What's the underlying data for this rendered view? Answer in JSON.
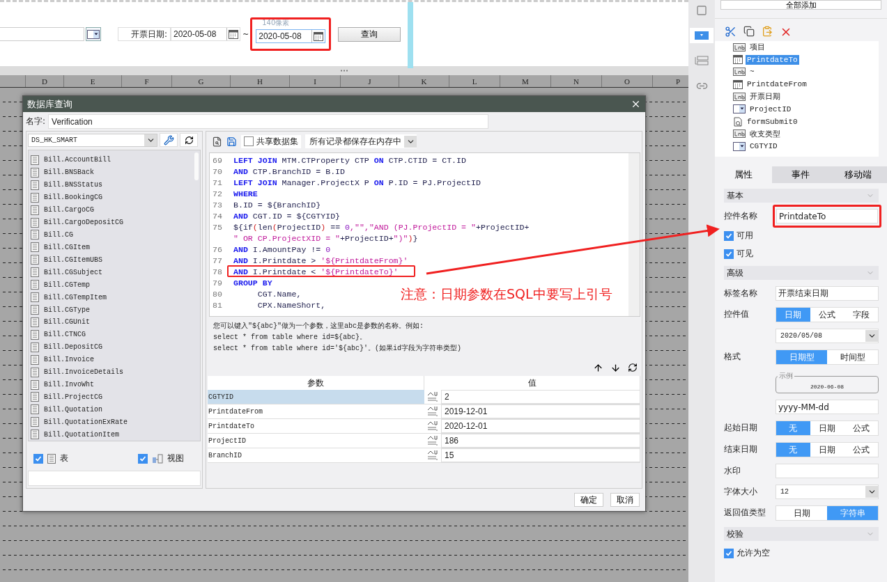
{
  "top_form": {
    "date_label": "开票日期:",
    "date_from": "2020-05-08",
    "separator": "~",
    "size_hint": "140像素",
    "date_to": "2020-05-08",
    "query_button": "查询"
  },
  "sheet": {
    "columns": [
      "D",
      "E",
      "F",
      "G",
      "H",
      "I",
      "J",
      "K",
      "L",
      "M",
      "N",
      "O",
      "P"
    ]
  },
  "dialog": {
    "title": "数据库查询",
    "name_label": "名字:",
    "name_value": "Verification",
    "datasource": "DS_HK_SMART",
    "tables": [
      "Bill.AccountBill",
      "Bill.BNSBack",
      "Bill.BNSStatus",
      "Bill.BookingCG",
      "Bill.CargoCG",
      "Bill.CargoDepositCG",
      "Bill.CG",
      "Bill.CGItem",
      "Bill.CGItemUBS",
      "Bill.CGSubject",
      "Bill.CGTemp",
      "Bill.CGTempItem",
      "Bill.CGType",
      "Bill.CGUnit",
      "Bill.CTNCG",
      "Bill.DepositCG",
      "Bill.Invoice",
      "Bill.InvoiceDetails",
      "Bill.InvoWht",
      "Bill.ProjectCG",
      "Bill.Quotation",
      "Bill.QuotationExRate",
      "Bill.QuotationItem"
    ],
    "filters": [
      {
        "kind": "table",
        "label": "表",
        "checked": true
      },
      {
        "kind": "view",
        "label": "视图",
        "checked": true
      }
    ],
    "share_label": "共享数据集",
    "share_checked": false,
    "cache_mode": "所有记录都保存在内存中",
    "sql_lines": [
      {
        "no": "69",
        "segments": [
          {
            "kind": "kw",
            "text": "LEFT JOIN "
          },
          {
            "kind": "id",
            "text": "MTM.CTProperty CTP "
          },
          {
            "kind": "kw",
            "text": "ON "
          },
          {
            "kind": "id",
            "text": "CTP.CTID = CT.ID"
          }
        ]
      },
      {
        "no": "70",
        "segments": [
          {
            "kind": "kw",
            "text": "AND "
          },
          {
            "kind": "id",
            "text": "CTP.BranchID = B.ID"
          }
        ]
      },
      {
        "no": "71",
        "segments": [
          {
            "kind": "kw",
            "text": "LEFT JOIN "
          },
          {
            "kind": "id",
            "text": "Manager.ProjectX P "
          },
          {
            "kind": "kw",
            "text": "ON "
          },
          {
            "kind": "id",
            "text": "P.ID = PJ.ProjectID"
          }
        ]
      },
      {
        "no": "72",
        "segments": [
          {
            "kind": "kw",
            "text": "WHERE"
          }
        ]
      },
      {
        "no": "73",
        "segments": [
          {
            "kind": "id",
            "text": "B.ID = ${BranchID}"
          }
        ]
      },
      {
        "no": "74",
        "segments": [
          {
            "kind": "kw",
            "text": "AND "
          },
          {
            "kind": "id",
            "text": "CGT.ID = ${CGTYID}"
          }
        ]
      },
      {
        "no": "75",
        "segments": [
          {
            "kind": "id",
            "text": "${if"
          },
          {
            "kind": "paren",
            "text": "("
          },
          {
            "kind": "id",
            "text": "len"
          },
          {
            "kind": "paren",
            "text": "("
          },
          {
            "kind": "id",
            "text": "ProjectID"
          },
          {
            "kind": "paren",
            "text": ")"
          },
          {
            "kind": "id",
            "text": " == "
          },
          {
            "kind": "num",
            "text": "0"
          },
          {
            "kind": "str",
            "text": ",\"\",\"AND (PJ.ProjectID = \""
          },
          {
            "kind": "id",
            "text": "+ProjectID+"
          }
        ]
      },
      {
        "segments": [
          {
            "kind": "str",
            "text": "\" OR CP.ProjectXID = \""
          },
          {
            "kind": "id",
            "text": "+ProjectID+"
          },
          {
            "kind": "str",
            "text": "\")\""
          },
          {
            "kind": "paren",
            "text": ")"
          },
          {
            "kind": "id",
            "text": "}"
          }
        ]
      },
      {
        "no": "76",
        "segments": [
          {
            "kind": "kw",
            "text": "AND "
          },
          {
            "kind": "id",
            "text": "I.AmountPay != "
          },
          {
            "kind": "num",
            "text": "0"
          }
        ]
      },
      {
        "no": "77",
        "segments": [
          {
            "kind": "kw",
            "text": "AND "
          },
          {
            "kind": "id",
            "text": "I.Printdate > "
          },
          {
            "kind": "str",
            "text": "'${PrintdateFrom}'"
          }
        ]
      },
      {
        "no": "78",
        "marked": true,
        "segments": [
          {
            "kind": "kw",
            "text": "AND "
          },
          {
            "kind": "id",
            "text": "I.Printdate < "
          },
          {
            "kind": "str",
            "text": "'${PrintdateTo}'"
          }
        ]
      },
      {
        "no": "79",
        "segments": [
          {
            "kind": "kw",
            "text": "GROUP BY"
          }
        ]
      },
      {
        "no": "80",
        "segments": [
          {
            "kind": "id",
            "text": "     CGT.Name,"
          }
        ]
      },
      {
        "no": "81",
        "segments": [
          {
            "kind": "id",
            "text": "     CPX.NameShort,"
          }
        ]
      }
    ],
    "help_lines": [
      "您可以键入\"${abc}\"做为一个参数，这里abc是参数的名称。例如:",
      "select * from table where id=${abc}。",
      "select * from table where id='${abc}'。(如果id字段为字符串类型)"
    ],
    "param_columns": [
      "参数",
      "值"
    ],
    "params": [
      {
        "name": "CGTYID",
        "value": "2",
        "selected": true
      },
      {
        "name": "PrintdateFrom",
        "value": "2019-12-01",
        "selected": false
      },
      {
        "name": "PrintdateTo",
        "value": "2020-12-01",
        "selected": false
      },
      {
        "name": "ProjectID",
        "value": "186",
        "selected": false
      },
      {
        "name": "BranchID",
        "value": "15",
        "selected": false
      }
    ],
    "buttons": [
      "确定",
      "取消"
    ]
  },
  "annotation": {
    "note": "注意：日期参数在SQL中要写上引号"
  },
  "side_tools": [
    {
      "kind": "frame",
      "selected": false
    },
    {
      "kind": "combo",
      "selected": true
    },
    {
      "kind": "form",
      "selected": false
    },
    {
      "kind": "link",
      "selected": false
    }
  ],
  "right_panel": {
    "add_all_button": "全部添加",
    "tree": [
      {
        "kind": "lab",
        "label": "项目",
        "selected": false
      },
      {
        "kind": "date",
        "label": "PrintdateTo",
        "selected": true
      },
      {
        "kind": "lab",
        "label": "~",
        "selected": false
      },
      {
        "kind": "date",
        "label": "PrintdateFrom",
        "selected": false
      },
      {
        "kind": "lab",
        "label": "开票日期",
        "selected": false
      },
      {
        "kind": "combo",
        "label": "ProjectID",
        "selected": false
      },
      {
        "kind": "submit",
        "label": "formSubmit0",
        "selected": false
      },
      {
        "kind": "lab",
        "label": "收支类型",
        "selected": false
      },
      {
        "kind": "combo",
        "label": "CGTYID",
        "selected": false
      }
    ],
    "tabs": [
      {
        "label": "属性",
        "selected": true
      },
      {
        "label": "事件",
        "selected": false
      },
      {
        "label": "移动端",
        "selected": false
      }
    ],
    "basic": {
      "title": "基本",
      "name_label": "控件名称",
      "name_value": "PrintdateTo",
      "checks": [
        {
          "label": "可用",
          "checked": true
        },
        {
          "label": "可见",
          "checked": true
        }
      ]
    },
    "advanced": {
      "title": "高级",
      "rows": [
        {
          "kind": "text",
          "label": "标签名称",
          "value": "开票结束日期"
        },
        {
          "kind": "segmented",
          "label": "控件值",
          "options": [
            {
              "label": "日期",
              "selected": true
            },
            {
              "label": "公式",
              "selected": false
            },
            {
              "label": "字段",
              "selected": false
            }
          ]
        },
        {
          "kind": "select",
          "value": "2020/05/08"
        },
        {
          "kind": "segmented",
          "label": "格式",
          "options": [
            {
              "label": "日期型",
              "selected": true
            },
            {
              "label": "时间型",
              "selected": false
            }
          ]
        },
        {
          "kind": "example",
          "legend": "示例",
          "value": "2020-06-08"
        },
        {
          "kind": "text",
          "value": "yyyy-MM-dd"
        },
        {
          "kind": "segmented",
          "label": "起始日期",
          "options": [
            {
              "label": "无",
              "selected": true
            },
            {
              "label": "日期",
              "selected": false
            },
            {
              "label": "公式",
              "selected": false
            }
          ]
        },
        {
          "kind": "segmented",
          "label": "结束日期",
          "options": [
            {
              "label": "无",
              "selected": true
            },
            {
              "label": "日期",
              "selected": false
            },
            {
              "label": "公式",
              "selected": false
            }
          ]
        },
        {
          "kind": "text",
          "label": "水印"
        },
        {
          "kind": "select",
          "label": "字体大小",
          "value": "12"
        },
        {
          "kind": "segmented",
          "label": "返回值类型",
          "options": [
            {
              "label": "日期",
              "selected": false
            },
            {
              "label": "字符串",
              "selected": true
            }
          ]
        }
      ]
    },
    "validation": {
      "title": "校验",
      "checks": [
        {
          "label": "允许为空",
          "checked": true
        }
      ]
    }
  }
}
